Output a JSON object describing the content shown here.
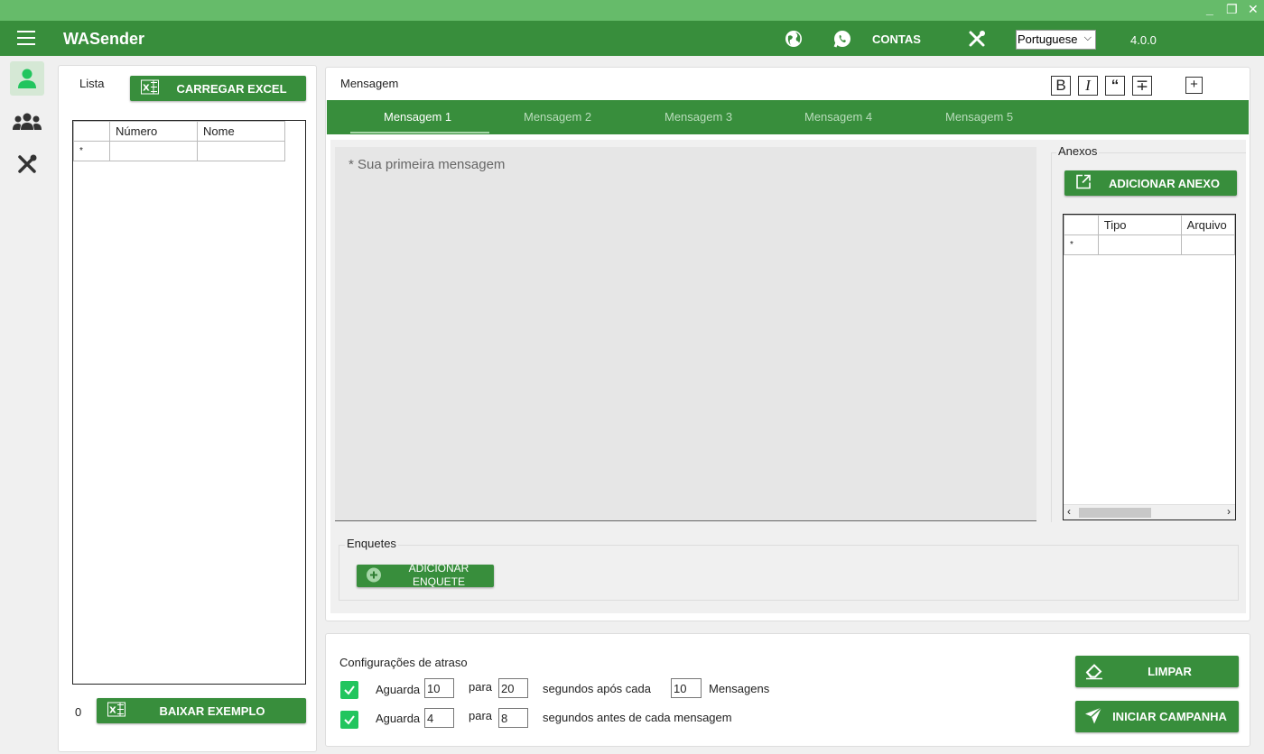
{
  "app": {
    "title": "WASender",
    "version": "4.0.0",
    "contas_label": "CONTAS",
    "language": "Portuguese"
  },
  "colors": {
    "primary": "#388e3c",
    "titlebar": "#66bb6a",
    "accent_check": "#22c55e"
  },
  "sidebar": {
    "items": [
      {
        "name": "user-icon",
        "active": true
      },
      {
        "name": "group-icon",
        "active": false
      },
      {
        "name": "tools-icon",
        "active": false
      }
    ]
  },
  "list_panel": {
    "title": "Lista",
    "load_excel": "CARREGAR EXCEL",
    "columns": [
      "Número",
      "Nome"
    ],
    "new_row_marker": "*",
    "count": "0",
    "download_example": "BAIXAR EXEMPLO"
  },
  "message_panel": {
    "title": "Mensagem",
    "format_buttons": [
      "bold-icon",
      "italic-icon",
      "quote-icon",
      "strikethrough-icon",
      "expand-icon"
    ],
    "tabs": [
      "Mensagem 1",
      "Mensagem 2",
      "Mensagem 3",
      "Mensagem 4",
      "Mensagem 5"
    ],
    "active_tab": 0,
    "placeholder": "* Sua primeira mensagem",
    "attachments": {
      "title": "Anexos",
      "add_button": "ADICIONAR ANEXO",
      "columns": [
        "Tipo",
        "Arquivo"
      ],
      "new_row_marker": "*"
    },
    "polls": {
      "title": "Enquetes",
      "add_button_line1": "ADICIONAR",
      "add_button_line2": "ENQUETE"
    }
  },
  "delay_panel": {
    "title": "Configurações de atraso",
    "rows": [
      {
        "checked": true,
        "wait_label": "Aguarda",
        "from": "10",
        "to_label": "para",
        "to": "20",
        "suffix": "segundos após cada",
        "count": "10",
        "count_label": "Mensagens"
      },
      {
        "checked": true,
        "wait_label": "Aguarda",
        "from": "4",
        "to_label": "para",
        "to": "8",
        "suffix": "segundos antes de cada mensagem"
      }
    ],
    "clear_button": "LIMPAR",
    "start_button": "INICIAR CAMPANHA"
  }
}
